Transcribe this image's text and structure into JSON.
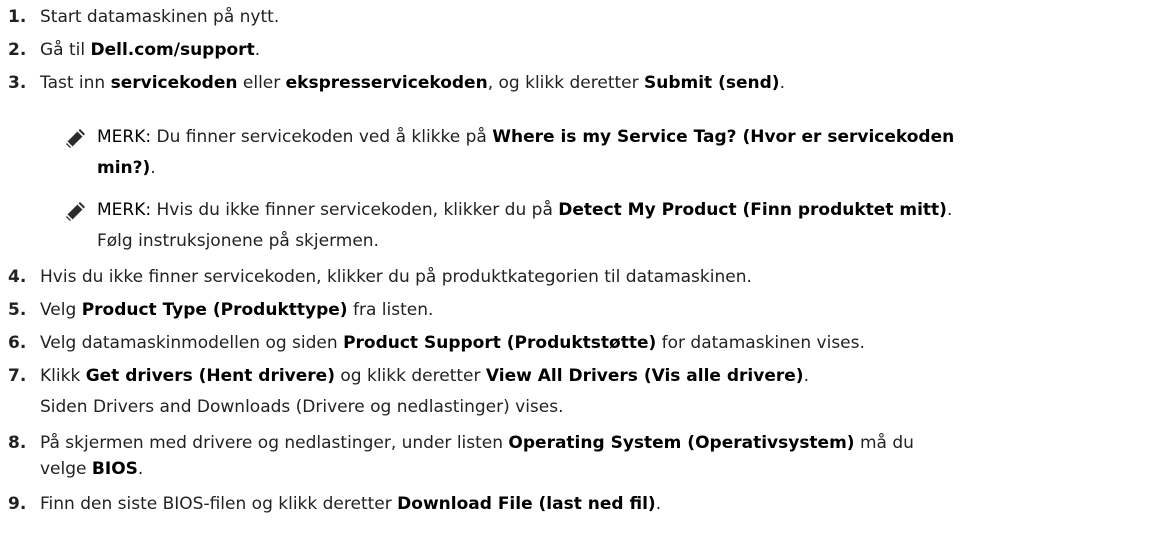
{
  "steps": [
    {
      "number": "1.",
      "parts": [
        {
          "t": "Start datamaskinen på nytt.",
          "b": false
        }
      ]
    },
    {
      "number": "2.",
      "parts": [
        {
          "t": "Gå til ",
          "b": false
        },
        {
          "t": "Dell.com/support",
          "b": true
        },
        {
          "t": ".",
          "b": false
        }
      ]
    },
    {
      "number": "3.",
      "parts": [
        {
          "t": "Tast inn ",
          "b": false
        },
        {
          "t": "servicekoden",
          "b": true
        },
        {
          "t": " eller ",
          "b": false
        },
        {
          "t": "ekspresservicekoden",
          "b": true
        },
        {
          "t": ", og klikk deretter ",
          "b": false
        },
        {
          "t": "Submit (send)",
          "b": true
        },
        {
          "t": ".",
          "b": false
        }
      ]
    },
    {
      "number": "4.",
      "parts": [
        {
          "t": "Hvis du ikke finner servicekoden, klikker du på produktkategorien til datamaskinen.",
          "b": false
        }
      ]
    },
    {
      "number": "5.",
      "parts": [
        {
          "t": "Velg ",
          "b": false
        },
        {
          "t": "Product Type (Produkttype)",
          "b": true
        },
        {
          "t": " fra listen.",
          "b": false
        }
      ]
    },
    {
      "number": "6.",
      "parts": [
        {
          "t": "Velg datamaskinmodellen og siden ",
          "b": false
        },
        {
          "t": "Product Support (Produktstøtte)",
          "b": true
        },
        {
          "t": " for datamaskinen vises.",
          "b": false
        }
      ]
    },
    {
      "number": "7.",
      "parts": [
        {
          "t": "Klikk ",
          "b": false
        },
        {
          "t": "Get drivers (Hent drivere)",
          "b": true
        },
        {
          "t": " og klikk deretter ",
          "b": false
        },
        {
          "t": "View All Drivers (Vis alle drivere)",
          "b": true
        },
        {
          "t": ".",
          "b": false
        }
      ]
    },
    {
      "number": "8.",
      "parts": [
        {
          "t": "På skjermen med drivere og nedlastinger, under listen ",
          "b": false
        },
        {
          "t": "Operating System (Operativsystem)",
          "b": true
        },
        {
          "t": " må du",
          "b": false
        }
      ]
    },
    {
      "number": "9.",
      "parts": [
        {
          "t": "Finn den siste BIOS-filen og klikk deretter ",
          "b": false
        },
        {
          "t": "Download File (last ned fil)",
          "b": true
        },
        {
          "t": ".",
          "b": false
        }
      ]
    }
  ],
  "step8_continuation": [
    {
      "t": "velge ",
      "b": false
    },
    {
      "t": "BIOS",
      "b": true
    },
    {
      "t": ".",
      "b": false
    }
  ],
  "step7_sub": "Siden Drivers and Downloads (Drivere og nedlastinger) vises.",
  "notes": [
    {
      "icon": "note-pencil-icon",
      "label": "MERK:",
      "line1": [
        {
          "t": " Du finner servicekoden ved å klikke på ",
          "b": false
        },
        {
          "t": "Where is my Service Tag? (Hvor er servicekoden",
          "b": true
        }
      ],
      "line2": [
        {
          "t": "min?)",
          "b": true
        },
        {
          "t": ".",
          "b": false
        }
      ]
    },
    {
      "icon": "note-pencil-icon",
      "label": "MERK:",
      "line1": [
        {
          "t": " Hvis du ikke finner servicekoden, klikker du på ",
          "b": false
        },
        {
          "t": "Detect My Product (Finn produktet mitt)",
          "b": true
        },
        {
          "t": ".",
          "b": false
        }
      ],
      "line2": [
        {
          "t": "Følg instruksjonene på skjermen.",
          "b": false
        }
      ]
    }
  ],
  "colors": {
    "text": "#222222",
    "emphasis": "#000000",
    "icon": "#2b2b2b"
  }
}
